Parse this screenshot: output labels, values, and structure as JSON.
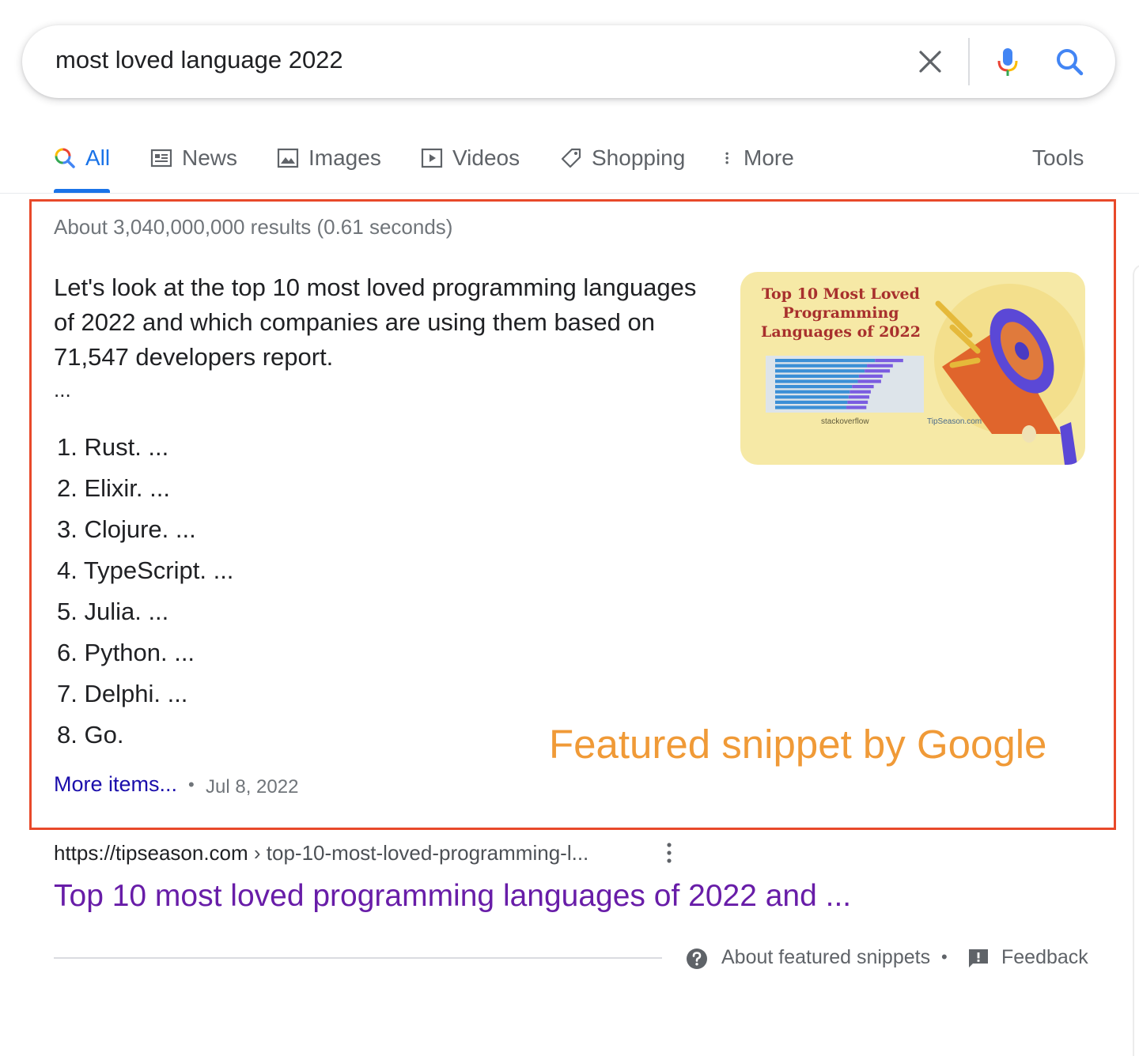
{
  "search": {
    "query": "most loved language 2022",
    "icons": [
      "close-icon",
      "microphone-icon",
      "search-icon"
    ]
  },
  "tabs": [
    {
      "label": "All",
      "icon": "search-multicolor-icon",
      "active": true
    },
    {
      "label": "News",
      "icon": "newspaper-icon"
    },
    {
      "label": "Images",
      "icon": "image-icon"
    },
    {
      "label": "Videos",
      "icon": "play-icon"
    },
    {
      "label": "Shopping",
      "icon": "tag-icon"
    },
    {
      "label": "More",
      "icon": "vertical-dots-icon"
    }
  ],
  "tools_label": "Tools",
  "result_stats": "About 3,040,000,000 results (0.61 seconds)",
  "snippet": {
    "text": "Let's look at the top 10 most loved programming languages of 2022 and which companies are using them based on 71,547 developers report.",
    "ellipsis": "...",
    "items": [
      "1. Rust. ...",
      "2. Elixir. ...",
      "3. Clojure. ...",
      "4. TypeScript. ...",
      "5. Julia. ...",
      "6. Python. ...",
      "7. Delphi. ...",
      "8. Go."
    ],
    "more_items": "More items...",
    "separator": "•",
    "date": "Jul 8, 2022",
    "thumbnail": {
      "title": "Top 10 Most Loved Programming Languages of 2022",
      "brand": "stackoverflow",
      "site": "TipSeason.com",
      "bar_fractions": [
        0.87,
        0.8,
        0.78,
        0.73,
        0.72,
        0.67,
        0.65,
        0.64,
        0.63,
        0.62
      ]
    }
  },
  "annotation": "Featured snippet by Google",
  "result": {
    "cite_domain": "https://tipseason.com",
    "cite_path": " › top-10-most-loved-programming-l...",
    "title": "Top 10 most loved programming languages of 2022 and ..."
  },
  "footer": {
    "about": "About featured snippets",
    "dot": "•",
    "feedback": "Feedback"
  },
  "colors": {
    "accent": "#1a73e8",
    "link": "#1a0dab",
    "visited_link": "#681da8",
    "annotation_frame": "#e8492a",
    "annotation_text": "#f09a37"
  }
}
